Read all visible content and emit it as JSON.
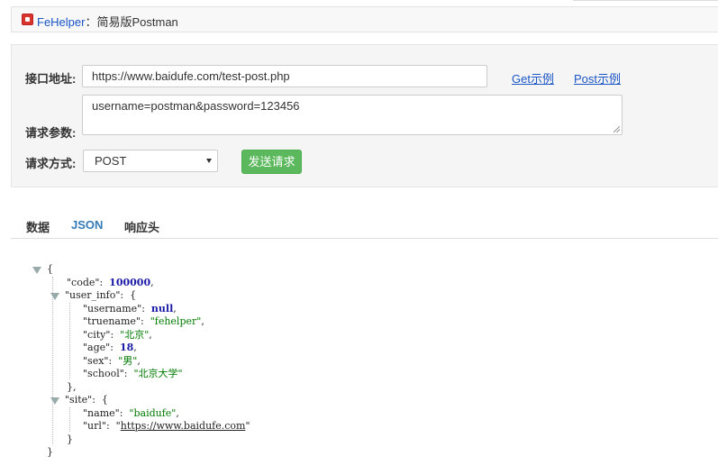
{
  "header": {
    "brand": "FeHelper",
    "separator": "：",
    "subtitle": "简易版Postman",
    "logo_icon": "fehelper-logo-icon"
  },
  "form": {
    "url_label": "接口地址:",
    "url_value": "https://www.baidufe.com/test-post.php",
    "get_example_label": "Get示例",
    "post_example_label": "Post示例",
    "params_label": "请求参数:",
    "params_value": "username=postman&password=123456",
    "method_label": "请求方式:",
    "method_value": "POST",
    "send_label": "发送请求"
  },
  "tabs": [
    {
      "label": "数据"
    },
    {
      "label": "JSON"
    },
    {
      "label": "响应头"
    }
  ],
  "json_view": {
    "open_brace": "{",
    "close_brace": "}",
    "code_key": "\"code\"",
    "code_value": "100000",
    "user_info_key": "\"user_info\"",
    "username_key": "\"username\"",
    "username_value": "null",
    "truename_key": "\"truename\"",
    "truename_value": "\"fehelper\"",
    "city_key": "\"city\"",
    "city_value": "\"北京\"",
    "age_key": "\"age\"",
    "age_value": "18",
    "sex_key": "\"sex\"",
    "sex_value": "\"男\"",
    "school_key": "\"school\"",
    "school_value": "\"北京大学\"",
    "site_key": "\"site\"",
    "name_key": "\"name\"",
    "name_value": "\"baidufe\"",
    "url_key": "\"url\"",
    "url_value": "https://www.baidufe.com"
  },
  "colors": {
    "brand": "#1a55c5",
    "send_button": "#5cb85c",
    "active_tab": "#337ab7",
    "json_number": "#1a1aa6",
    "json_string": "#007a00"
  }
}
